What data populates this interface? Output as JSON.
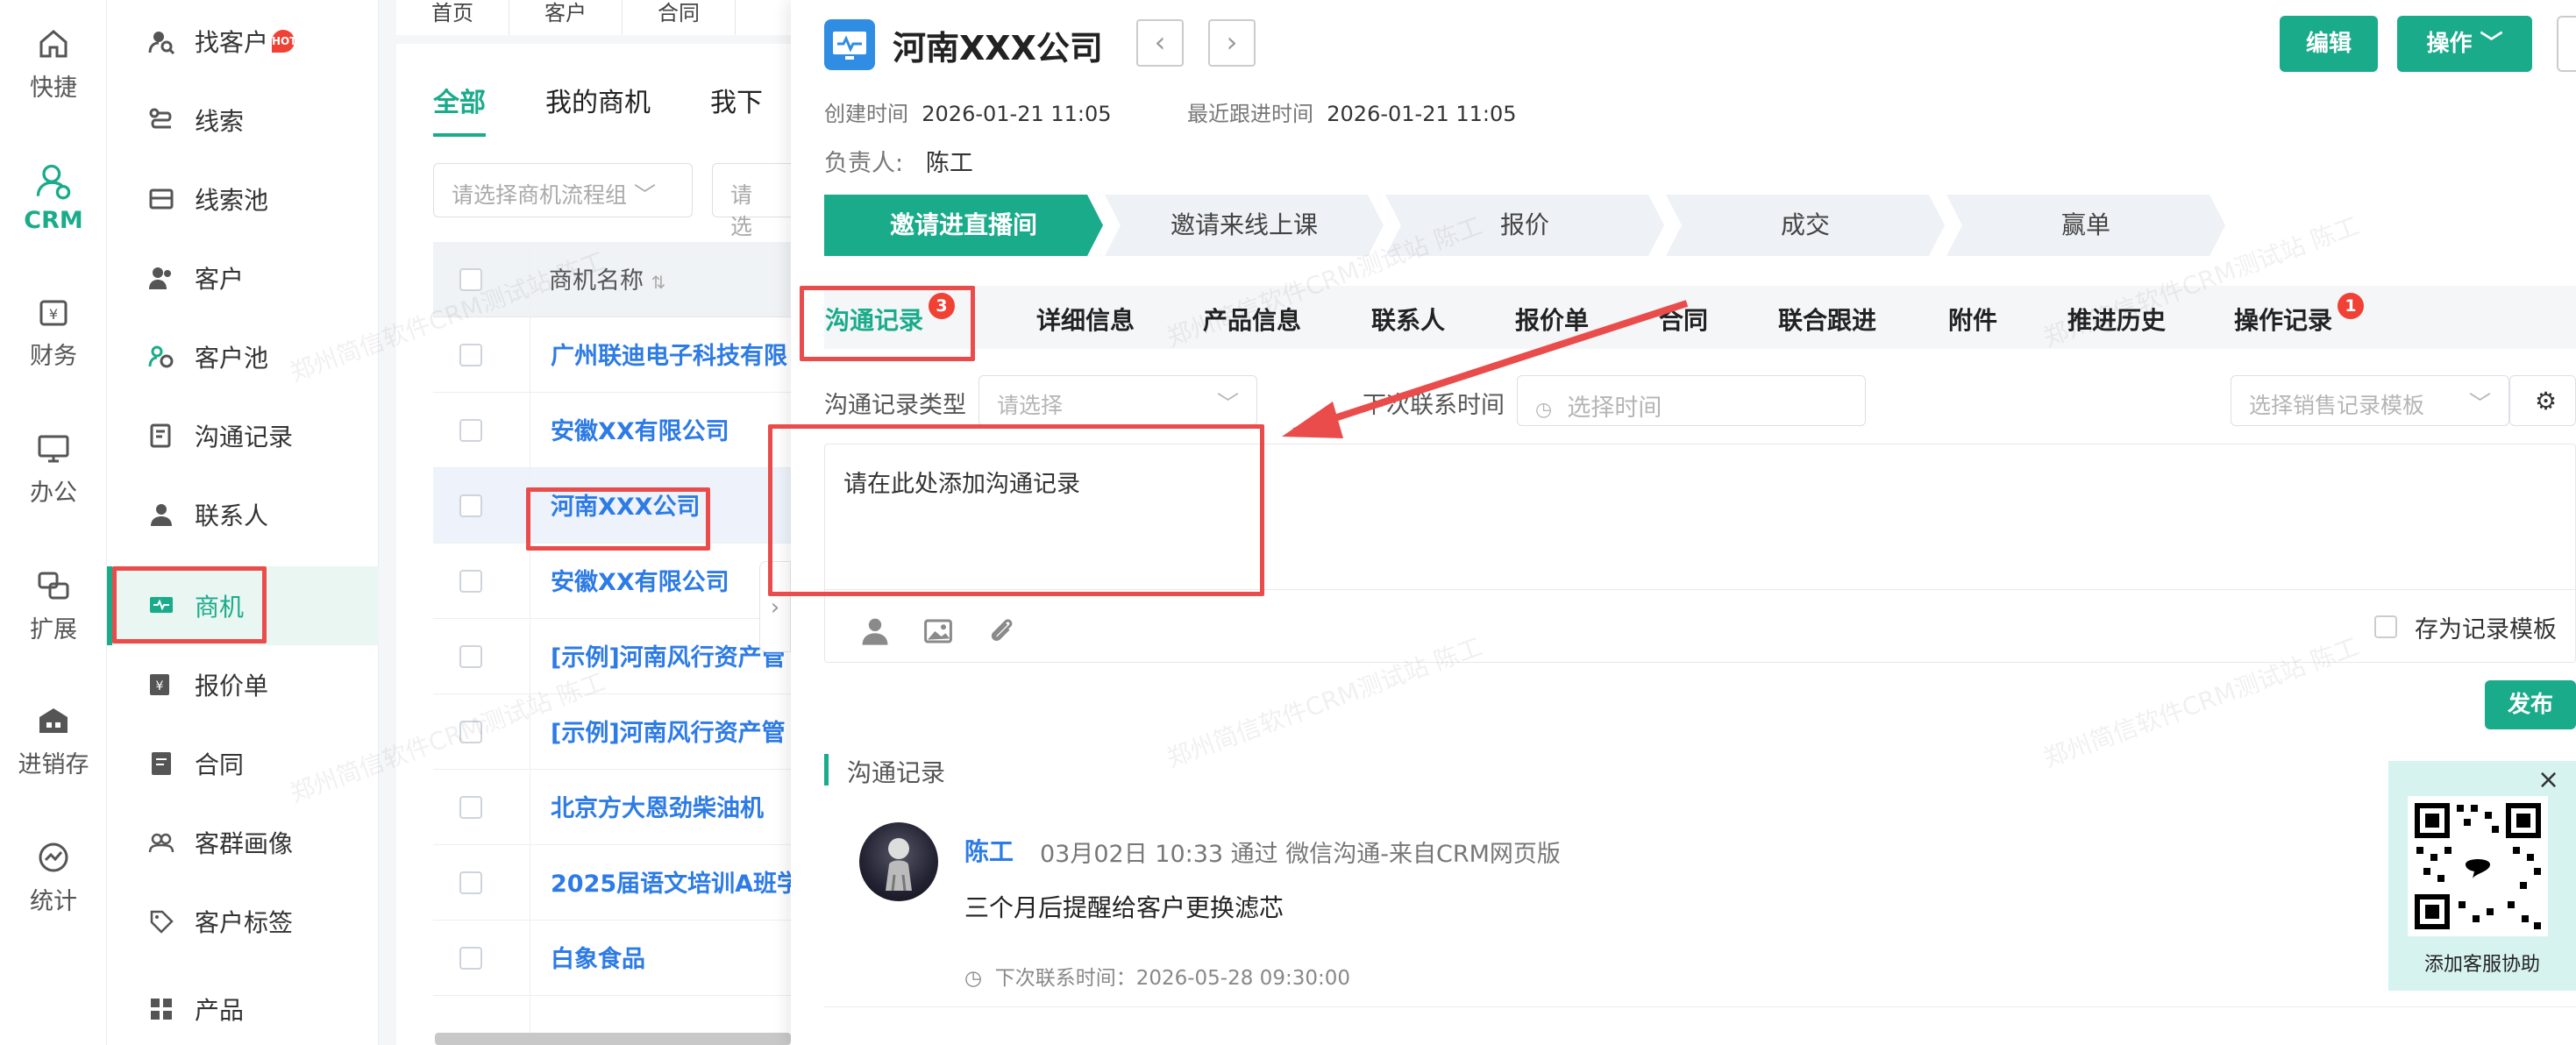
{
  "rail": [
    {
      "label": "快捷",
      "icon": "home-icon"
    },
    {
      "label": "CRM",
      "icon": "crm-user-icon",
      "active": true
    },
    {
      "label": "财务",
      "icon": "finance-icon"
    },
    {
      "label": "办公",
      "icon": "monitor-icon"
    },
    {
      "label": "扩展",
      "icon": "extend-icon"
    },
    {
      "label": "进销存",
      "icon": "warehouse-icon"
    },
    {
      "label": "统计",
      "icon": "stats-icon"
    }
  ],
  "menu": [
    {
      "label": "找客户",
      "hot": "HOT"
    },
    {
      "label": "线索"
    },
    {
      "label": "线索池"
    },
    {
      "label": "客户"
    },
    {
      "label": "客户池"
    },
    {
      "label": "沟通记录"
    },
    {
      "label": "联系人"
    },
    {
      "label": "商机",
      "active": true
    },
    {
      "label": "报价单"
    },
    {
      "label": "合同"
    },
    {
      "label": "客群画像"
    },
    {
      "label": "客户标签"
    },
    {
      "label": "产品"
    }
  ],
  "topnav": [
    "首页",
    "客户",
    "合同"
  ],
  "list": {
    "tabs": [
      "全部",
      "我的商机",
      "我下"
    ],
    "filter_flow_placeholder": "请选择商机流程组",
    "filter2_placeholder": "请选",
    "column_name": "商机名称",
    "rows": [
      "广州联迪电子科技有限",
      "安徽XX有限公司",
      "河南XXX公司",
      "安徽XX有限公司",
      "[示例]河南风行资产管",
      "[示例]河南风行资产管",
      "北京方大恩劲柴油机",
      "2025届语文培训A班学",
      "白象食品"
    ]
  },
  "detail": {
    "title": "河南XXX公司",
    "edit_label": "编辑",
    "action_label": "操作 ﹀",
    "created_label": "创建时间",
    "created_value": "2026-01-21 11:05",
    "followed_label": "最近跟进时间",
    "followed_value": "2026-01-21 11:05",
    "owner_label": "负责人:",
    "owner_value": "陈工",
    "stages": [
      "邀请进直播间",
      "邀请来线上课",
      "报价",
      "成交",
      "赢单"
    ],
    "tabs": [
      {
        "label": "沟通记录",
        "badge": "3"
      },
      {
        "label": "详细信息"
      },
      {
        "label": "产品信息"
      },
      {
        "label": "联系人"
      },
      {
        "label": "报价单"
      },
      {
        "label": "合同"
      },
      {
        "label": "联合跟进"
      },
      {
        "label": "附件"
      },
      {
        "label": "推进历史"
      },
      {
        "label": "操作记录",
        "badge": "1"
      }
    ],
    "form": {
      "type_label": "沟通记录类型",
      "type_placeholder": "请选择",
      "next_label": "下次联系时间",
      "next_placeholder": "选择时间",
      "template_placeholder": "选择销售记录模板",
      "editor_text": "请在此处添加沟通记录",
      "save_template_label": "存为记录模板",
      "publish_label": "发布"
    },
    "records_title": "沟通记录",
    "record": {
      "name": "陈工",
      "meta": "03月02日 10:33 通过 微信沟通-来自CRM网页版",
      "body": "三个月后提醒给客户更换滤芯",
      "next": "下次联系时间：2026-05-28 09:30:00"
    }
  },
  "qr": {
    "label": "添加客服协助",
    "close": "×"
  },
  "watermark": "郑州简信软件CRM测试站 陈工",
  "colors": {
    "accent": "#1aab8a",
    "link": "#2d7be5",
    "annotation": "#ea4b4b",
    "badge": "#f04134"
  }
}
